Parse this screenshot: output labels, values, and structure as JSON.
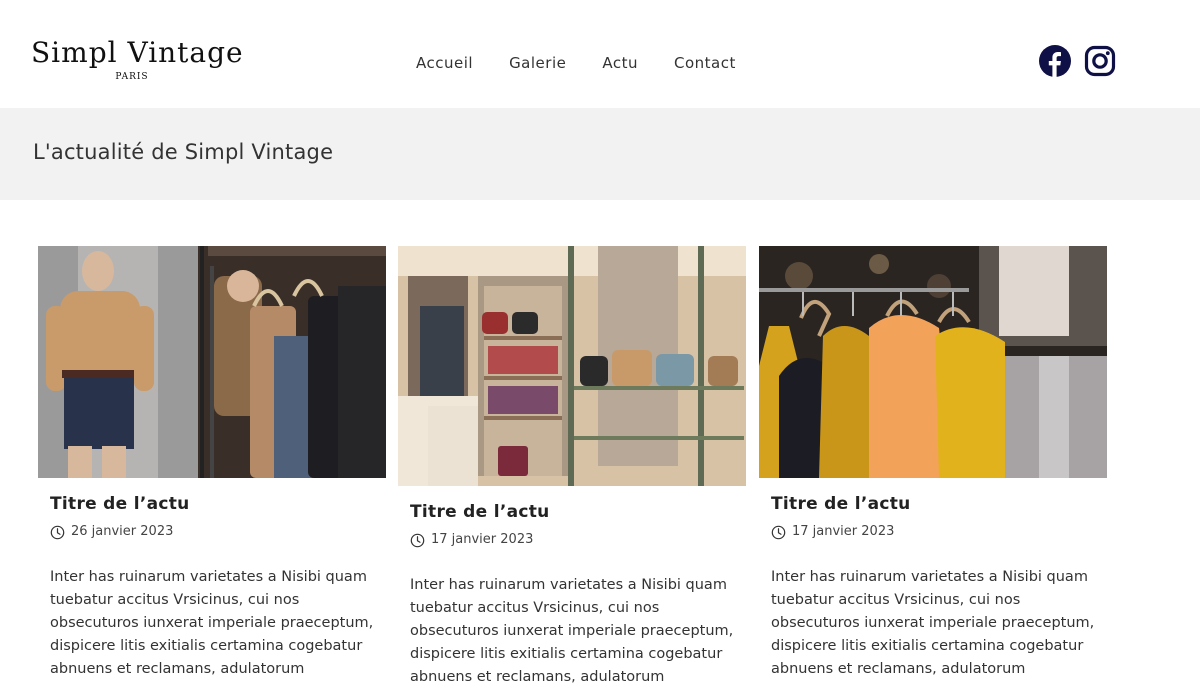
{
  "brand": {
    "name": "Simpl Vintage",
    "city": "PARIS"
  },
  "nav": {
    "items": [
      "Accueil",
      "Galerie",
      "Actu",
      "Contact"
    ]
  },
  "social": {
    "facebook_icon": "facebook-icon",
    "instagram_icon": "instagram-icon",
    "icon_color": "#0f1045"
  },
  "page": {
    "title": "L'actualité de Simpl Vintage",
    "band_color": "#f2f2f2"
  },
  "articles": [
    {
      "image": "clothing-store-mannequin-photo",
      "title": "Titre de l’actu",
      "date": "26 janvier 2023",
      "excerpt": "Inter has ruinarum varietates a Nisibi quam tuebatur accitus Vrsicinus, cui nos obsecuturos iunxerat imperiale praeceptum, dispicere litis exitialis certamina cogebatur abnuens et reclamans, adulatorum"
    },
    {
      "image": "handbag-boutique-interior-photo",
      "title": "Titre de l’actu",
      "date": "17 janvier 2023",
      "excerpt": "Inter has ruinarum varietates a Nisibi quam tuebatur accitus Vrsicinus, cui nos obsecuturos iunxerat imperiale praeceptum, dispicere litis exitialis certamina cogebatur abnuens et reclamans, adulatorum"
    },
    {
      "image": "colorful-tops-on-hangers-photo",
      "title": "Titre de l’actu",
      "date": "17 janvier 2023",
      "excerpt": "Inter has ruinarum varietates a Nisibi quam tuebatur accitus Vrsicinus, cui nos obsecuturos iunxerat imperiale praeceptum, dispicere litis exitialis certamina cogebatur abnuens et reclamans, adulatorum"
    }
  ]
}
